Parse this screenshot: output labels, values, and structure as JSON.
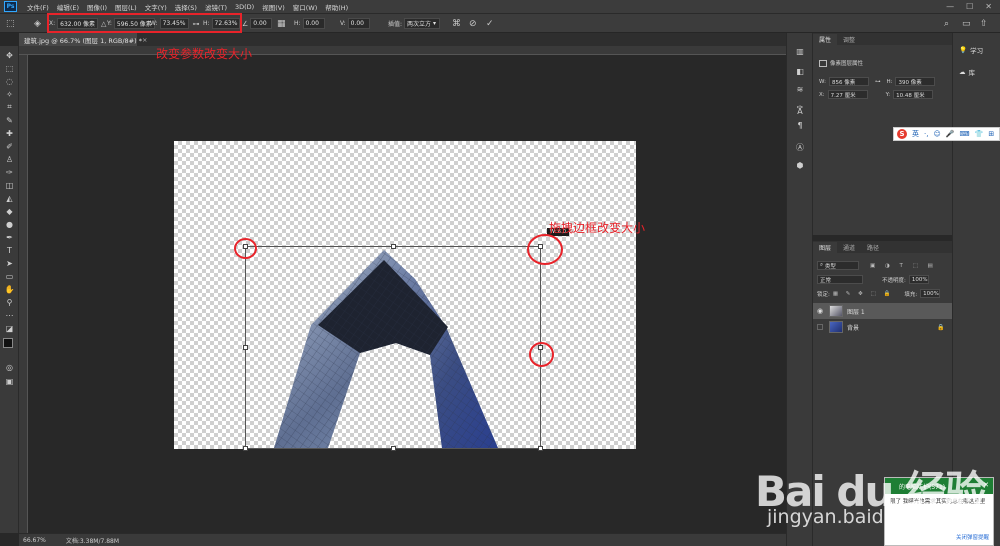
{
  "app": {
    "logo": "Ps"
  },
  "menu": [
    "文件(F)",
    "编辑(E)",
    "图像(I)",
    "图层(L)",
    "文字(Y)",
    "选择(S)",
    "滤镜(T)",
    "3D(D)",
    "视图(V)",
    "窗口(W)",
    "帮助(H)"
  ],
  "window_controls": [
    "—",
    "☐",
    "✕"
  ],
  "options": {
    "x_label": "X:",
    "x_value": "632.00 像素",
    "y_label": "Y:",
    "y_value": "596.50 像素",
    "w_label": "W:",
    "w_value": "73.45%",
    "h_label": "H:",
    "h_value": "72.63%",
    "angle_value": "0.00",
    "hskew_label": "H:",
    "hskew_value": "0.00",
    "vskew_label": "V:",
    "vskew_value": "0.00",
    "interp_label": "插值:",
    "interp_value": "两次立方"
  },
  "document": {
    "tab_title": "建筑.jpg @ 66.7% (图层 1, RGB/8#) *",
    "close": "×"
  },
  "annotations": {
    "params_note": "改变参数改变大小",
    "drag_note": "拖拽边框改变大小",
    "size_tip": "W: 6.0"
  },
  "status": {
    "zoom": "66.67%",
    "doc_size": "文档:3.38M/7.88M"
  },
  "properties_panel": {
    "tabs": [
      "属性",
      "调整"
    ],
    "section_title": "像素图层属性",
    "w_label": "W:",
    "w_value": "856 像素",
    "h_label": "H:",
    "h_value": "390 像素",
    "x_label": "X:",
    "x_value": "7.27 厘米",
    "y_label": "Y:",
    "y_value": "10.48 厘米"
  },
  "layers_panel": {
    "tabs": [
      "图层",
      "通道",
      "路径"
    ],
    "filter_kind": "类型",
    "blend_mode": "正常",
    "opacity_label": "不透明度:",
    "opacity_value": "100%",
    "lock_label": "锁定:",
    "fill_label": "填充:",
    "fill_value": "100%",
    "layers": [
      {
        "name": "图层 1"
      },
      {
        "name": "背景"
      }
    ]
  },
  "right_dock": {
    "learn": "学习",
    "library": "库"
  },
  "sogou": {
    "logo": "S",
    "mode": "英"
  },
  "notification": {
    "title": "的电脑防护(571)",
    "body": "限了  我曝光也需求其实约总在哪这里里",
    "link": "关闭弹窗提醒"
  },
  "watermark": {
    "brand": "Bai du 经验",
    "url": "jingyan.baidu.com"
  }
}
